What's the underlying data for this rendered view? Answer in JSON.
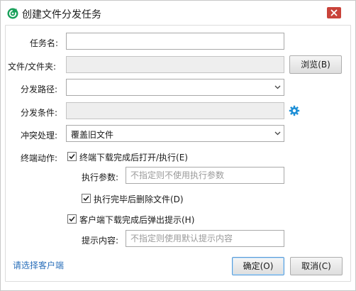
{
  "window": {
    "title": "创建文件分发任务",
    "icon_name": "app-logo-icon",
    "close_icon": "close-icon"
  },
  "form": {
    "task_name": {
      "label": "任务名:",
      "value": ""
    },
    "file": {
      "label": "文件/文件夹:",
      "value": "",
      "browse_button": "浏览(B)"
    },
    "distribution_path": {
      "label": "分发路径:",
      "value": ""
    },
    "distribution_condition": {
      "label": "分发条件:",
      "value": "",
      "settings_icon": "gear-icon"
    },
    "conflict_handling": {
      "label": "冲突处理:",
      "value": "覆盖旧文件"
    },
    "endpoint_action": {
      "label": "终端动作:",
      "open_after_download": {
        "label": "终端下载完成后打开/执行(E)",
        "checked": true
      },
      "exec_params": {
        "label": "执行参数:",
        "placeholder": "不指定则不使用执行参数",
        "value": ""
      },
      "delete_after_exec": {
        "label": "执行完毕后删除文件(D)",
        "checked": true
      },
      "popup_after_download": {
        "label": "客户端下载完成后弹出提示(H)",
        "checked": true
      },
      "prompt_content": {
        "label": "提示内容:",
        "placeholder": "不指定则使用默认提示内容",
        "value": ""
      }
    }
  },
  "footer": {
    "select_client_link": "请选择客户端",
    "ok_button": "确定(O)",
    "cancel_button": "取消(C)"
  },
  "colors": {
    "link": "#2a6fba",
    "accent": "#1e8fd6",
    "logo": "#19a05a",
    "close_red": "#c0392b"
  }
}
